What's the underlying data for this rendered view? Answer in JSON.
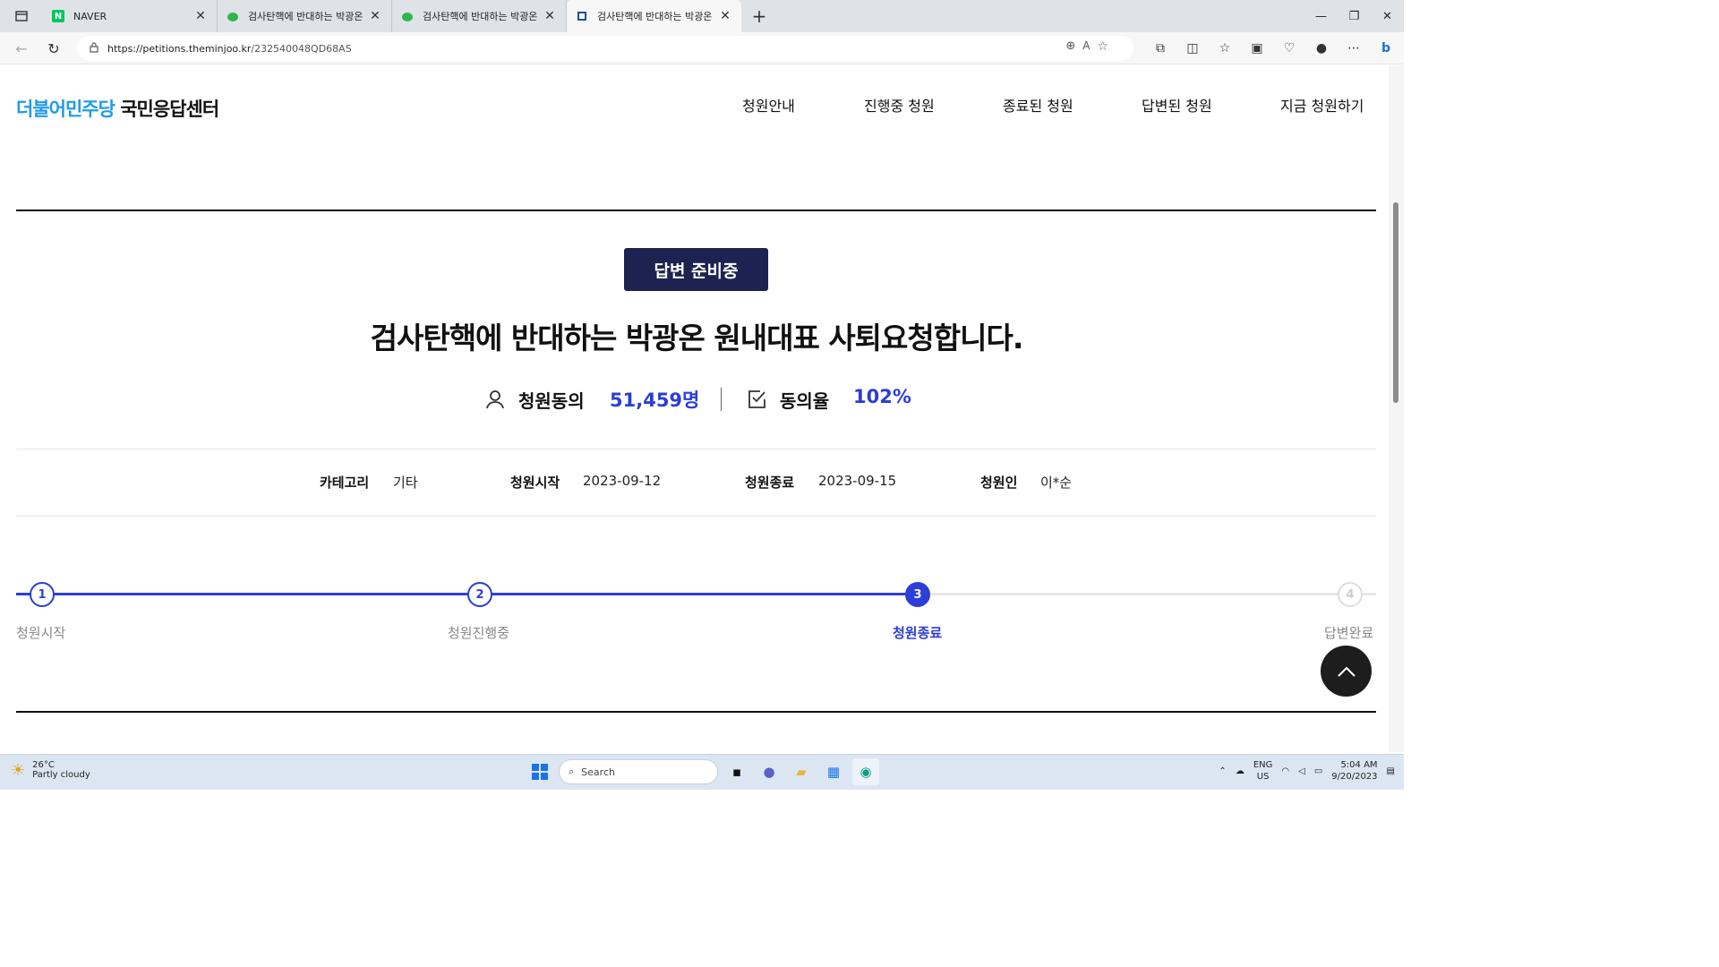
{
  "browser": {
    "tabs": [
      {
        "title": "NAVER",
        "favicon": "naver-icon",
        "active": false
      },
      {
        "title": "검사탄핵에 반대하는 박광온",
        "favicon": "leaf-icon",
        "active": false
      },
      {
        "title": "검사탄핵에 반대하는 박광온",
        "favicon": "leaf-icon",
        "active": false
      },
      {
        "title": "검사탄핵에 반대하는 박광온",
        "favicon": "flag-icon",
        "active": true
      }
    ],
    "url_host": "https://petitions.theminjoo.kr",
    "url_path": "/232540048QD68AS"
  },
  "site": {
    "logo_party": "더불어민주당",
    "logo_center": "국민응답센터",
    "nav": [
      "청원안내",
      "진행중 청원",
      "종료된 청원",
      "답변된 청원",
      "지금 청원하기"
    ]
  },
  "petition": {
    "status_badge": "답변 준비중",
    "title": "검사탄핵에 반대하는 박광온 원내대표 사퇴요청합니다.",
    "agree_label": "청원동의",
    "agree_count": "51,459명",
    "rate_label": "동의율",
    "rate_value": "102%",
    "meta": {
      "category_label": "카테고리",
      "category_value": "기타",
      "start_label": "청원시작",
      "start_value": "2023-09-12",
      "end_label": "청원종료",
      "end_value": "2023-09-15",
      "petitioner_label": "청원인",
      "petitioner_value": "이*순"
    },
    "steps": [
      {
        "num": "1",
        "label": "청원시작",
        "state": "done"
      },
      {
        "num": "2",
        "label": "청원진행중",
        "state": "done"
      },
      {
        "num": "3",
        "label": "청원종료",
        "state": "current"
      },
      {
        "num": "4",
        "label": "답변완료",
        "state": "todo"
      }
    ],
    "progress_fraction": 0.667
  },
  "colors": {
    "accent": "#2b3ed8",
    "badge_bg": "#1c2350",
    "logo_blue": "#1e9be8"
  },
  "taskbar": {
    "temperature": "26°C",
    "weather": "Partly cloudy",
    "search_placeholder": "Search",
    "lang_top": "ENG",
    "lang_bottom": "US",
    "time": "5:04 AM",
    "date": "9/20/2023"
  }
}
